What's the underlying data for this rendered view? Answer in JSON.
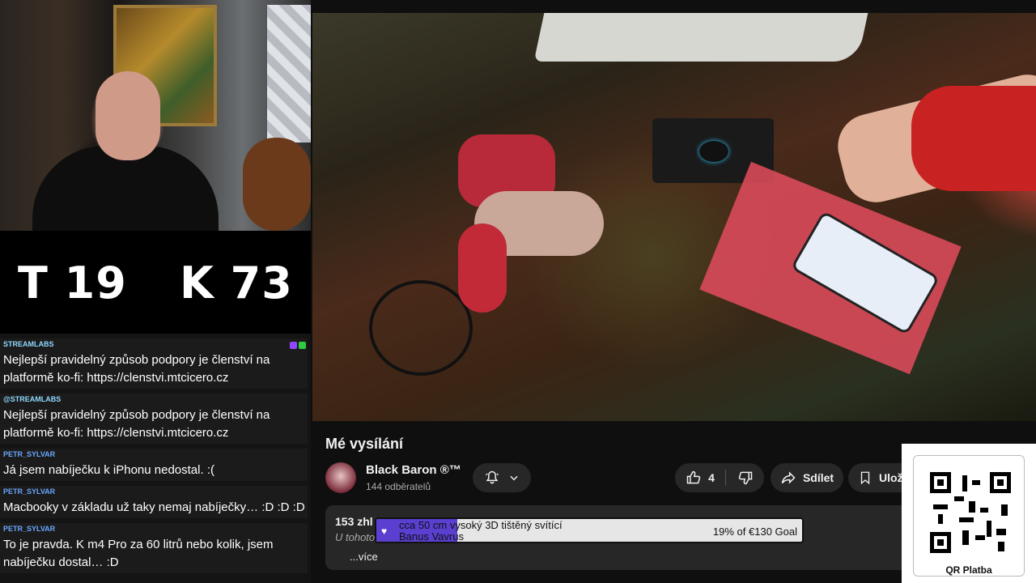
{
  "counter": {
    "t": "T 19",
    "k": "K 73"
  },
  "chat": [
    {
      "user": "STREAMLABS",
      "color": "#8fd9ff",
      "text": "Nejlepší pravidelný způsob podpory je členství na platformě ko-fi: https://clenstvi.mtcicero.cz"
    },
    {
      "user": "@STREAMLABS",
      "color": "#8fd9ff",
      "text": "Nejlepší pravidelný způsob podpory je členství na platformě ko-fi: https://clenstvi.mtcicero.cz"
    },
    {
      "user": "PETR_SYLVAR",
      "color": "#6aa7ff",
      "text": "Já jsem nabíječku k iPhonu nedostal. :("
    },
    {
      "user": "PETR_SYLVAR",
      "color": "#6aa7ff",
      "text": "Macbooky v základu už taky nemaj nabíječky… :D :D :D"
    },
    {
      "user": "PETR_SYLVAR",
      "color": "#6aa7ff",
      "text": "To je pravda. K m4 Pro za 60 litrů nebo kolik, jsem nabíječku dostal… :D"
    }
  ],
  "video": {
    "title": "Mé vysílání",
    "channel": "Black Baron ®™",
    "subscribers": "144 odběratelů",
    "likes": "4",
    "share_label": "Sdílet",
    "save_label": "Ulož",
    "views": "153 zhl",
    "description_preview": "U tohoto",
    "more_label": "...více"
  },
  "goal": {
    "title": "cca 50 cm vysoký 3D tištěný svítící",
    "backer": "Banus Vavrus",
    "progress_text": "19% of €130 Goal",
    "progress_fraction": 0.19,
    "accent": "#5a3fd0"
  },
  "qr": {
    "label": "QR Platba"
  },
  "icons": [
    "bell-icon",
    "chevron-down-icon",
    "thumbs-up-icon",
    "thumbs-down-icon",
    "share-icon",
    "bookmark-icon",
    "heart-icon"
  ]
}
